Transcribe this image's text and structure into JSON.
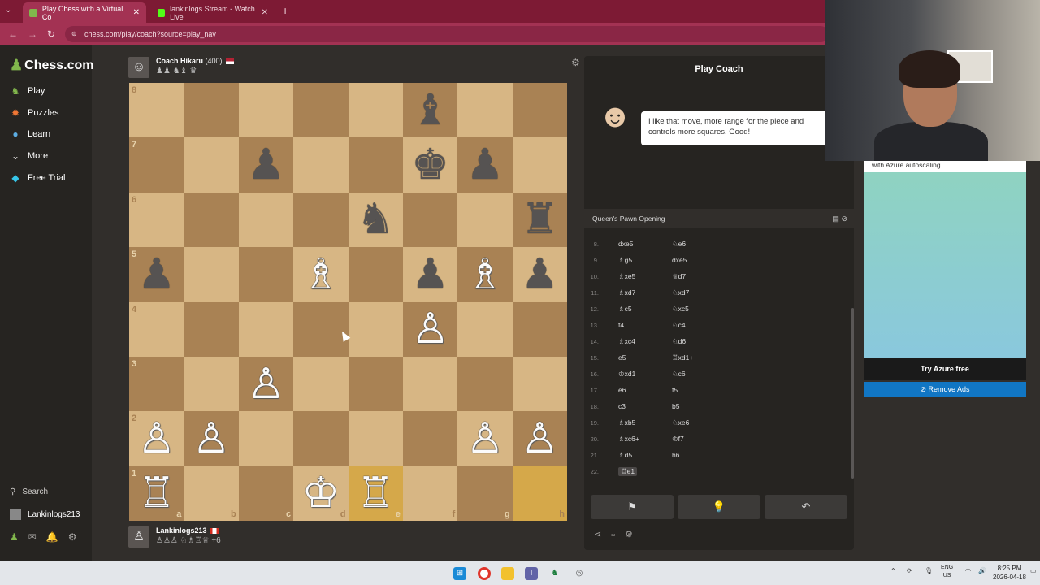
{
  "browser": {
    "tabs": [
      {
        "title": "Play Chess with a Virtual Co",
        "active": true
      },
      {
        "title": "lankinlogs Stream - Watch Live",
        "active": false
      }
    ],
    "url": "chess.com/play/coach?source=play_nav"
  },
  "sidebar": {
    "logo": "Chess.com",
    "items": [
      {
        "label": "Play",
        "icon": "play-icon",
        "color": "#81b64c"
      },
      {
        "label": "Puzzles",
        "icon": "puzzle-icon",
        "color": "#f07735"
      },
      {
        "label": "Learn",
        "icon": "learn-icon",
        "color": "#5dade2"
      },
      {
        "label": "More",
        "icon": "chevron-down-icon",
        "color": "#ffffff"
      },
      {
        "label": "Free Trial",
        "icon": "diamond-icon",
        "color": "#36c5e8"
      }
    ],
    "search_label": "Search",
    "username": "Lankinlogs213"
  },
  "top_player": {
    "name": "Coach Hikaru",
    "rating": "(400)",
    "captured": "♟♟ ♞♝ ♛"
  },
  "bottom_player": {
    "name": "Lankinlogs213",
    "captured": "♙♙♙ ♘♗♖♕",
    "advantage": "+6"
  },
  "board": {
    "highlight_color": "#d5a84a",
    "files": [
      "a",
      "b",
      "c",
      "d",
      "e",
      "f",
      "g",
      "h"
    ],
    "ranks": [
      "8",
      "7",
      "6",
      "5",
      "4",
      "3",
      "2",
      "1"
    ],
    "squares": [
      [
        "",
        "",
        "",
        "",
        "",
        "b:♝",
        "",
        ""
      ],
      [
        "",
        "",
        "b:♟",
        "",
        "",
        "b:♚",
        "b:♟",
        ""
      ],
      [
        "",
        "",
        "",
        "",
        "b:♞",
        "",
        "",
        "b:♜"
      ],
      [
        "b:♟",
        "",
        "",
        "w:♗",
        "",
        "b:♟",
        "w:♗",
        "b:♟"
      ],
      [
        "",
        "",
        "",
        "",
        "",
        "w:♙",
        "",
        ""
      ],
      [
        "",
        "",
        "w:♙",
        "",
        "",
        "",
        "",
        ""
      ],
      [
        "w:♙",
        "w:♙",
        "",
        "",
        "",
        "",
        "w:♙",
        "w:♙"
      ],
      [
        "w:♖",
        "",
        "",
        "w:♔",
        "w:♖",
        "",
        "",
        ""
      ]
    ],
    "highlighted_squares": [
      "e1",
      "h1"
    ]
  },
  "panel": {
    "title": "Play Coach",
    "coach_message": "I like that move, more range for the piece and controls more squares. Good!",
    "opening": "Queen's Pawn Opening",
    "moves": [
      {
        "num": "8.",
        "white": "dxe5",
        "black": "♘e6"
      },
      {
        "num": "9.",
        "white": "♗g5",
        "black": "dxe5"
      },
      {
        "num": "10.",
        "white": "♗xe5",
        "black": "♕d7"
      },
      {
        "num": "11.",
        "white": "♗xd7",
        "black": "♘xd7"
      },
      {
        "num": "12.",
        "white": "♗c5",
        "black": "♘xc5"
      },
      {
        "num": "13.",
        "white": "f4",
        "black": "♘c4"
      },
      {
        "num": "14.",
        "white": "♗xc4",
        "black": "♘d6"
      },
      {
        "num": "15.",
        "white": "e5",
        "black": "♖xd1+"
      },
      {
        "num": "16.",
        "white": "♔xd1",
        "black": "♘c6"
      },
      {
        "num": "17.",
        "white": "e6",
        "black": "f5"
      },
      {
        "num": "18.",
        "white": "c3",
        "black": "b5"
      },
      {
        "num": "19.",
        "white": "♗xb5",
        "black": "♘xe6"
      },
      {
        "num": "20.",
        "white": "♗xc6+",
        "black": "♔f7"
      },
      {
        "num": "21.",
        "white": "♗d5",
        "black": "h6"
      },
      {
        "num": "22.",
        "white": "♖e1",
        "black": ""
      }
    ],
    "controls": [
      {
        "name": "resign-button",
        "icon": "⚑"
      },
      {
        "name": "hint-button",
        "icon": "💡"
      },
      {
        "name": "undo-button",
        "icon": "↶"
      }
    ]
  },
  "ad": {
    "text": "with Azure autoscaling.",
    "cta": "Try Azure free",
    "remove": "Remove Ads"
  },
  "taskbar": {
    "lang_top": "ENG",
    "lang_bottom": "US",
    "time": "8:25 PM",
    "date": "2026-04-18"
  }
}
